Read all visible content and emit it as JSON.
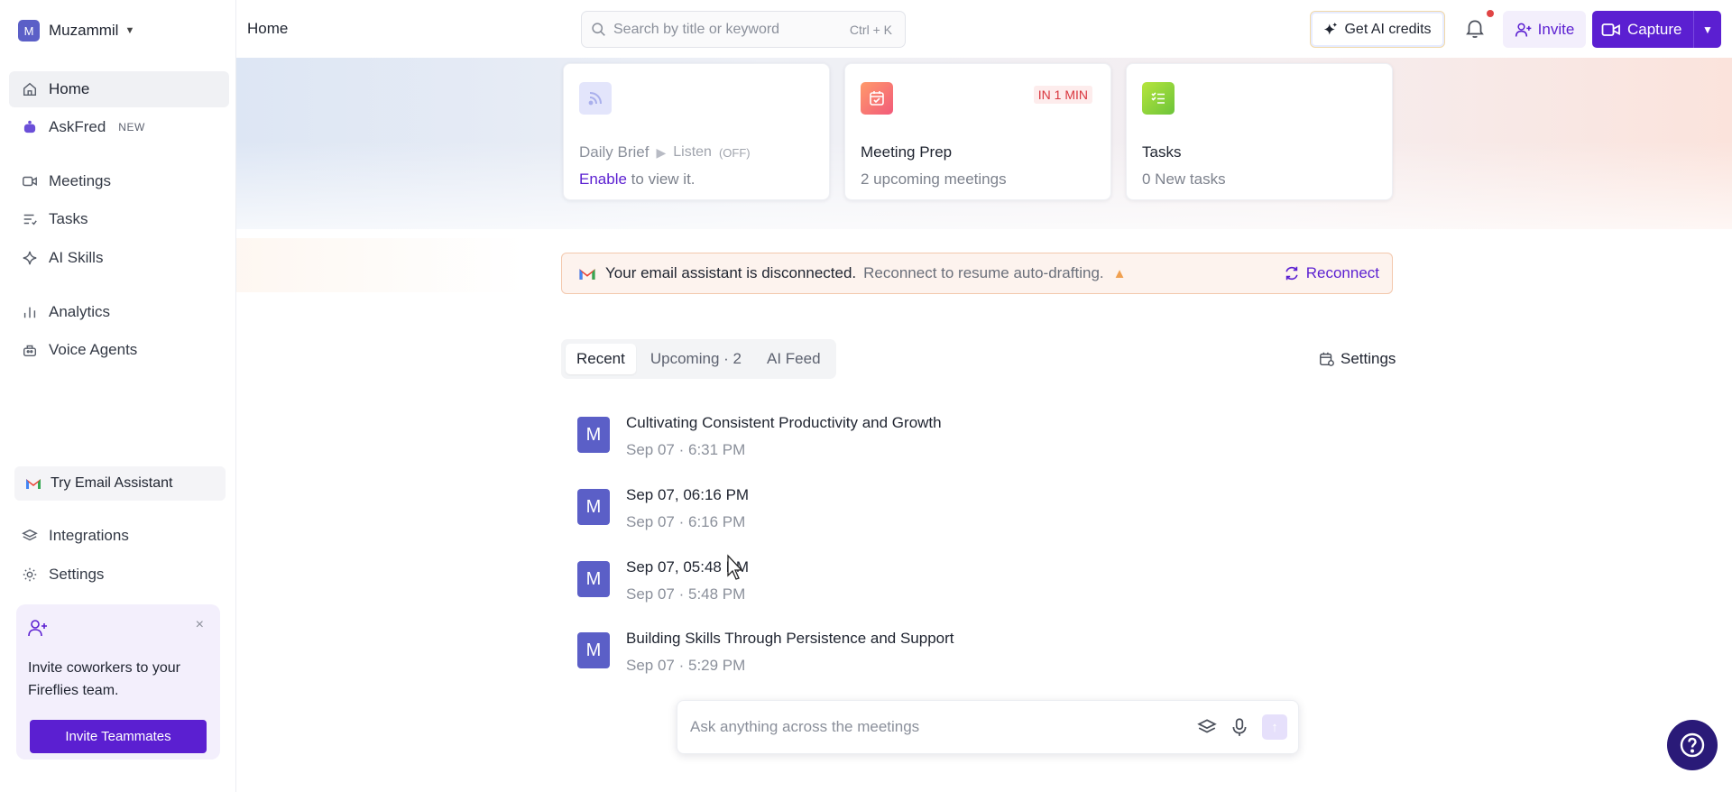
{
  "workspace": {
    "avatar_letter": "M",
    "name": "Muzammil"
  },
  "sidebar": {
    "items": [
      {
        "label": "Home",
        "icon": "home-icon"
      },
      {
        "label": "AskFred",
        "badge": "NEW",
        "icon": "robot-icon"
      },
      {
        "label": "Meetings",
        "icon": "video-icon"
      },
      {
        "label": "Tasks",
        "icon": "list-icon"
      },
      {
        "label": "AI Skills",
        "icon": "sparkle-icon"
      },
      {
        "label": "Analytics",
        "icon": "bar-chart-icon"
      },
      {
        "label": "Voice Agents",
        "icon": "voice-agent-icon"
      },
      {
        "label": "Integrations",
        "icon": "layers-icon"
      },
      {
        "label": "Settings",
        "icon": "gear-icon"
      }
    ],
    "try_email": "Try Email Assistant",
    "invite_card": {
      "text": "Invite coworkers to your Fireflies team.",
      "button": "Invite Teammates",
      "close": "×"
    }
  },
  "header": {
    "breadcrumb": "Home",
    "search_placeholder": "Search by title or keyword",
    "search_shortcut": "Ctrl + K",
    "ai_credits": "Get AI credits",
    "invite": "Invite",
    "capture": "Capture"
  },
  "cards": {
    "daily_brief": {
      "title": "Daily Brief",
      "listen": "Listen",
      "listen_state": "(OFF)",
      "enable_link": "Enable",
      "enable_rest": "to view it."
    },
    "meeting_prep": {
      "title": "Meeting Prep",
      "subtitle": "2 upcoming meetings",
      "badge": "IN 1 MIN"
    },
    "tasks": {
      "title": "Tasks",
      "subtitle": "0 New tasks"
    }
  },
  "email_banner": {
    "strong": "Your email assistant is disconnected.",
    "rest": "Reconnect to resume auto-drafting.",
    "action": "Reconnect"
  },
  "tabs": [
    {
      "label": "Recent",
      "active": true
    },
    {
      "label": "Upcoming · 2",
      "active": false
    },
    {
      "label": "AI Feed",
      "active": false
    }
  ],
  "settings_link": "Settings",
  "meetings": [
    {
      "avatar": "M",
      "title": "Cultivating Consistent Productivity and Growth",
      "date": "Sep 07",
      "time": "6:31 PM"
    },
    {
      "avatar": "M",
      "title": "Sep 07, 06:16 PM",
      "date": "Sep 07",
      "time": "6:16 PM"
    },
    {
      "avatar": "M",
      "title": "Sep 07, 05:48 PM",
      "date": "Sep 07",
      "time": "5:48 PM"
    },
    {
      "avatar": "M",
      "title": "Building Skills Through Persistence and Support",
      "date": "Sep 07",
      "time": "5:29 PM"
    }
  ],
  "ask": {
    "placeholder": "Ask anything across the meetings"
  },
  "colors": {
    "accent": "#5b1fd1",
    "avatar": "#5b5fc7",
    "help": "#2a1a78",
    "alert": "#d9363e"
  }
}
